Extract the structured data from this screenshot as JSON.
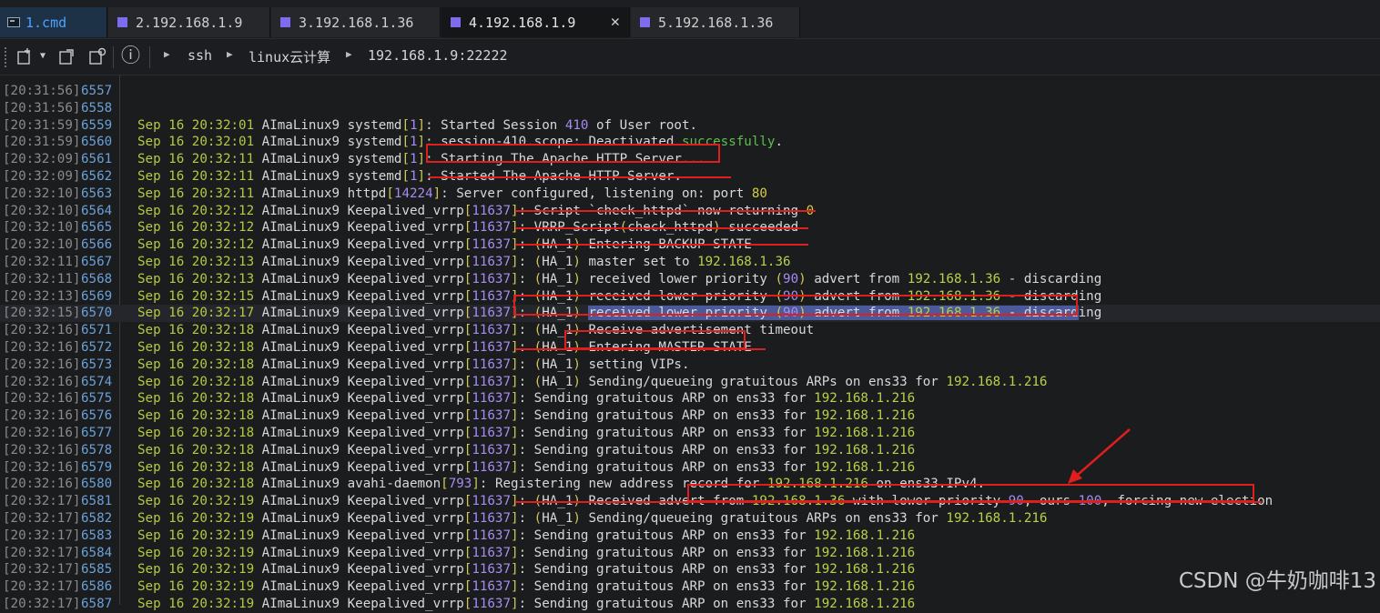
{
  "tabs": [
    {
      "label": "1.cmd",
      "kind": "cmd"
    },
    {
      "label": "2.192.168.1.9",
      "kind": "ssh"
    },
    {
      "label": "3.192.168.1.36",
      "kind": "ssh"
    },
    {
      "label": "4.192.168.1.9",
      "kind": "ssh",
      "active": true
    },
    {
      "label": "5.192.168.1.36",
      "kind": "ssh"
    }
  ],
  "close_glyph": "✕",
  "toolbar": {
    "info_glyph": "ⓘ",
    "breadcrumb": [
      "ssh",
      "linux云计算",
      "192.168.1.9:22222"
    ]
  },
  "terminal": {
    "empty_rows": [
      {
        "ts": "[20:31:56]",
        "ln": "6557"
      },
      {
        "ts": "[20:31:56]",
        "ln": "6558"
      }
    ],
    "rows": [
      {
        "ts": "[20:31:59]",
        "ln": "6559",
        "date": "Sep 16 20:32:01",
        "host": "AImaLinux9",
        "proc": "systemd",
        "pid": "1",
        "segs": [
          [
            "t",
            "Started Session "
          ],
          [
            "n",
            "410"
          ],
          [
            "t",
            " of User root."
          ]
        ]
      },
      {
        "ts": "[20:31:59]",
        "ln": "6560",
        "date": "Sep 16 20:32:01",
        "host": "AImaLinux9",
        "proc": "systemd",
        "pid": "1",
        "segs": [
          [
            "t",
            "session-410.scope: Deactivated "
          ],
          [
            "ok",
            "successfully"
          ],
          [
            "t",
            "."
          ]
        ]
      },
      {
        "ts": "[20:32:09]",
        "ln": "6561",
        "date": "Sep 16 20:32:11",
        "host": "AImaLinux9",
        "proc": "systemd",
        "pid": "1",
        "segs": [
          [
            "t",
            "Starting The Apache HTTP Server..."
          ]
        ]
      },
      {
        "ts": "[20:32:09]",
        "ln": "6562",
        "date": "Sep 16 20:32:11",
        "host": "AImaLinux9",
        "proc": "systemd",
        "pid": "1",
        "segs": [
          [
            "t",
            "Started The Apache HTTP Server."
          ]
        ]
      },
      {
        "ts": "[20:32:10]",
        "ln": "6563",
        "date": "Sep 16 20:32:11",
        "host": "AImaLinux9",
        "proc": "httpd",
        "pid": "14224",
        "segs": [
          [
            "t",
            "Server configured, listening on: port "
          ],
          [
            "y",
            "80"
          ]
        ]
      },
      {
        "ts": "[20:32:10]",
        "ln": "6564",
        "date": "Sep 16 20:32:12",
        "host": "AImaLinux9",
        "proc": "Keepalived_vrrp",
        "pid": "11637",
        "segs": [
          [
            "t",
            "Script `check_httpd` now returning "
          ],
          [
            "y",
            "0"
          ]
        ]
      },
      {
        "ts": "[20:32:10]",
        "ln": "6565",
        "date": "Sep 16 20:32:12",
        "host": "AImaLinux9",
        "proc": "Keepalived_vrrp",
        "pid": "11637",
        "segs": [
          [
            "t",
            "VRRP_Script"
          ],
          [
            "br",
            "("
          ],
          [
            "t",
            "check_httpd"
          ],
          [
            "br",
            ")"
          ],
          [
            "t",
            " succeeded"
          ]
        ]
      },
      {
        "ts": "[20:32:10]",
        "ln": "6566",
        "date": "Sep 16 20:32:12",
        "host": "AImaLinux9",
        "proc": "Keepalived_vrrp",
        "pid": "11637",
        "segs": [
          [
            "br",
            "("
          ],
          [
            "t",
            "HA_1"
          ],
          [
            "br",
            ")"
          ],
          [
            "t",
            " Entering BACKUP STATE"
          ]
        ]
      },
      {
        "ts": "[20:32:11]",
        "ln": "6567",
        "date": "Sep 16 20:32:13",
        "host": "AImaLinux9",
        "proc": "Keepalived_vrrp",
        "pid": "11637",
        "segs": [
          [
            "br",
            "("
          ],
          [
            "t",
            "HA_1"
          ],
          [
            "br",
            ")"
          ],
          [
            "t",
            " master set to "
          ],
          [
            "ip",
            "192.168.1.36"
          ]
        ]
      },
      {
        "ts": "[20:32:11]",
        "ln": "6568",
        "date": "Sep 16 20:32:13",
        "host": "AImaLinux9",
        "proc": "Keepalived_vrrp",
        "pid": "11637",
        "segs": [
          [
            "br",
            "("
          ],
          [
            "t",
            "HA_1"
          ],
          [
            "br",
            ")"
          ],
          [
            "t",
            " received lower priority "
          ],
          [
            "br",
            "("
          ],
          [
            "n",
            "90"
          ],
          [
            "br",
            ")"
          ],
          [
            "t",
            " advert from "
          ],
          [
            "ip",
            "192.168.1.36"
          ],
          [
            "t",
            " - discarding"
          ]
        ]
      },
      {
        "ts": "[20:32:13]",
        "ln": "6569",
        "date": "Sep 16 20:32:15",
        "host": "AImaLinux9",
        "proc": "Keepalived_vrrp",
        "pid": "11637",
        "segs": [
          [
            "br",
            "("
          ],
          [
            "t",
            "HA_1"
          ],
          [
            "br",
            ")"
          ],
          [
            "t",
            " received lower priority "
          ],
          [
            "br",
            "("
          ],
          [
            "n",
            "90"
          ],
          [
            "br",
            ")"
          ],
          [
            "t",
            " advert from "
          ],
          [
            "ip",
            "192.168.1.36"
          ],
          [
            "t",
            " - discarding"
          ]
        ]
      },
      {
        "ts": "[20:32:15]",
        "ln": "6570",
        "date": "Sep 16 20:32:17",
        "host": "AImaLinux9",
        "proc": "Keepalived_vrrp",
        "pid": "11637",
        "hl": true,
        "segs": [
          [
            "br",
            "("
          ],
          [
            "t",
            "HA_1"
          ],
          [
            "br",
            ")"
          ],
          [
            "t",
            " "
          ],
          [
            "sel",
            "received lower priority "
          ],
          [
            "selbr",
            "("
          ],
          [
            "seln",
            "90"
          ],
          [
            "selbr",
            ")"
          ],
          [
            "sel",
            " advert from "
          ],
          [
            "selip",
            "192.168.1.36"
          ],
          [
            "sel",
            " - discard"
          ],
          [
            "t",
            "ing"
          ]
        ]
      },
      {
        "ts": "[20:32:16]",
        "ln": "6571",
        "date": "Sep 16 20:32:18",
        "host": "AImaLinux9",
        "proc": "Keepalived_vrrp",
        "pid": "11637",
        "segs": [
          [
            "br",
            "("
          ],
          [
            "t",
            "HA_1"
          ],
          [
            "br",
            ")"
          ],
          [
            "t",
            " Receive advertisement timeout"
          ]
        ]
      },
      {
        "ts": "[20:32:16]",
        "ln": "6572",
        "date": "Sep 16 20:32:18",
        "host": "AImaLinux9",
        "proc": "Keepalived_vrrp",
        "pid": "11637",
        "segs": [
          [
            "br",
            "("
          ],
          [
            "t",
            "HA_1"
          ],
          [
            "br",
            ")"
          ],
          [
            "t",
            " Entering MASTER STATE"
          ]
        ]
      },
      {
        "ts": "[20:32:16]",
        "ln": "6573",
        "date": "Sep 16 20:32:18",
        "host": "AImaLinux9",
        "proc": "Keepalived_vrrp",
        "pid": "11637",
        "segs": [
          [
            "br",
            "("
          ],
          [
            "t",
            "HA_1"
          ],
          [
            "br",
            ")"
          ],
          [
            "t",
            " setting VIPs."
          ]
        ]
      },
      {
        "ts": "[20:32:16]",
        "ln": "6574",
        "date": "Sep 16 20:32:18",
        "host": "AImaLinux9",
        "proc": "Keepalived_vrrp",
        "pid": "11637",
        "segs": [
          [
            "br",
            "("
          ],
          [
            "t",
            "HA_1"
          ],
          [
            "br",
            ")"
          ],
          [
            "t",
            " Sending/queueing gratuitous ARPs on ens33 for "
          ],
          [
            "ip",
            "192.168.1.216"
          ]
        ]
      },
      {
        "ts": "[20:32:16]",
        "ln": "6575",
        "date": "Sep 16 20:32:18",
        "host": "AImaLinux9",
        "proc": "Keepalived_vrrp",
        "pid": "11637",
        "segs": [
          [
            "t",
            "Sending gratuitous ARP on ens33 for "
          ],
          [
            "ip",
            "192.168.1.216"
          ]
        ]
      },
      {
        "ts": "[20:32:16]",
        "ln": "6576",
        "date": "Sep 16 20:32:18",
        "host": "AImaLinux9",
        "proc": "Keepalived_vrrp",
        "pid": "11637",
        "segs": [
          [
            "t",
            "Sending gratuitous ARP on ens33 for "
          ],
          [
            "ip",
            "192.168.1.216"
          ]
        ]
      },
      {
        "ts": "[20:32:16]",
        "ln": "6577",
        "date": "Sep 16 20:32:18",
        "host": "AImaLinux9",
        "proc": "Keepalived_vrrp",
        "pid": "11637",
        "segs": [
          [
            "t",
            "Sending gratuitous ARP on ens33 for "
          ],
          [
            "ip",
            "192.168.1.216"
          ]
        ]
      },
      {
        "ts": "[20:32:16]",
        "ln": "6578",
        "date": "Sep 16 20:32:18",
        "host": "AImaLinux9",
        "proc": "Keepalived_vrrp",
        "pid": "11637",
        "segs": [
          [
            "t",
            "Sending gratuitous ARP on ens33 for "
          ],
          [
            "ip",
            "192.168.1.216"
          ]
        ]
      },
      {
        "ts": "[20:32:16]",
        "ln": "6579",
        "date": "Sep 16 20:32:18",
        "host": "AImaLinux9",
        "proc": "Keepalived_vrrp",
        "pid": "11637",
        "segs": [
          [
            "t",
            "Sending gratuitous ARP on ens33 for "
          ],
          [
            "ip",
            "192.168.1.216"
          ]
        ]
      },
      {
        "ts": "[20:32:16]",
        "ln": "6580",
        "date": "Sep 16 20:32:18",
        "host": "AImaLinux9",
        "proc": "avahi-daemon",
        "pid": "793",
        "segs": [
          [
            "t",
            "Registering new address record for "
          ],
          [
            "ip",
            "192.168.1.216"
          ],
          [
            "t",
            " on ens33.IPv4."
          ]
        ]
      },
      {
        "ts": "[20:32:17]",
        "ln": "6581",
        "date": "Sep 16 20:32:19",
        "host": "AImaLinux9",
        "proc": "Keepalived_vrrp",
        "pid": "11637",
        "segs": [
          [
            "br",
            "("
          ],
          [
            "t",
            "HA_1"
          ],
          [
            "br",
            ")"
          ],
          [
            "t",
            " Received advert from "
          ],
          [
            "ip",
            "192.168.1.36"
          ],
          [
            "t",
            " with lower priority "
          ],
          [
            "n",
            "90"
          ],
          [
            "t",
            ", ours "
          ],
          [
            "n",
            "100"
          ],
          [
            "t",
            ", forcing new election"
          ]
        ]
      },
      {
        "ts": "[20:32:17]",
        "ln": "6582",
        "date": "Sep 16 20:32:19",
        "host": "AImaLinux9",
        "proc": "Keepalived_vrrp",
        "pid": "11637",
        "segs": [
          [
            "br",
            "("
          ],
          [
            "t",
            "HA_1"
          ],
          [
            "br",
            ")"
          ],
          [
            "t",
            " Sending/queueing gratuitous ARPs on ens33 for "
          ],
          [
            "ip",
            "192.168.1.216"
          ]
        ]
      },
      {
        "ts": "[20:32:17]",
        "ln": "6583",
        "date": "Sep 16 20:32:19",
        "host": "AImaLinux9",
        "proc": "Keepalived_vrrp",
        "pid": "11637",
        "segs": [
          [
            "t",
            "Sending gratuitous ARP on ens33 for "
          ],
          [
            "ip",
            "192.168.1.216"
          ]
        ]
      },
      {
        "ts": "[20:32:17]",
        "ln": "6584",
        "date": "Sep 16 20:32:19",
        "host": "AImaLinux9",
        "proc": "Keepalived_vrrp",
        "pid": "11637",
        "segs": [
          [
            "t",
            "Sending gratuitous ARP on ens33 for "
          ],
          [
            "ip",
            "192.168.1.216"
          ]
        ]
      },
      {
        "ts": "[20:32:17]",
        "ln": "6585",
        "date": "Sep 16 20:32:19",
        "host": "AImaLinux9",
        "proc": "Keepalived_vrrp",
        "pid": "11637",
        "segs": [
          [
            "t",
            "Sending gratuitous ARP on ens33 for "
          ],
          [
            "ip",
            "192.168.1.216"
          ]
        ]
      },
      {
        "ts": "[20:32:17]",
        "ln": "6586",
        "date": "Sep 16 20:32:19",
        "host": "AImaLinux9",
        "proc": "Keepalived_vrrp",
        "pid": "11637",
        "segs": [
          [
            "t",
            "Sending gratuitous ARP on ens33 for "
          ],
          [
            "ip",
            "192.168.1.216"
          ]
        ]
      },
      {
        "ts": "[20:32:17]",
        "ln": "6587",
        "date": "Sep 16 20:32:19",
        "host": "AImaLinux9",
        "proc": "Keepalived_vrrp",
        "pid": "11637",
        "segs": [
          [
            "t",
            "Sending gratuitous ARP on ens33 for "
          ],
          [
            "ip",
            "192.168.1.216"
          ]
        ]
      }
    ]
  },
  "watermark": "CSDN @牛奶咖啡13",
  "colors": {
    "annotation": "#e01e1e",
    "selection": "#4a5a9a",
    "accent_tab": "#4aa3ff"
  }
}
